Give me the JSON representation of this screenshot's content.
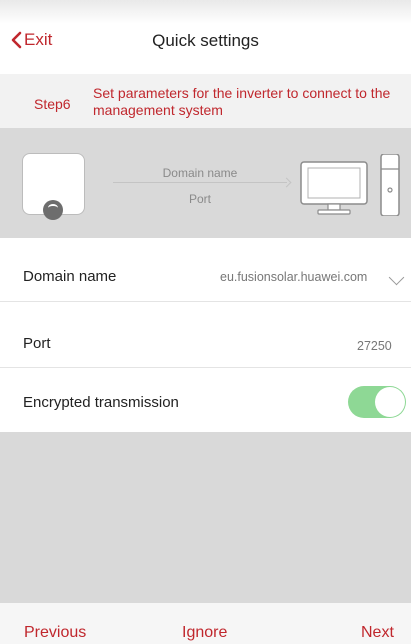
{
  "header": {
    "exit_label": "Exit",
    "title": "Quick settings"
  },
  "step": {
    "label": "Step6",
    "description": "Set parameters for the inverter to connect to the management system"
  },
  "diagram": {
    "line1": "Domain name",
    "line2": "Port",
    "left_device_icon": "inverter-icon",
    "right_device_icon": "computer-icon"
  },
  "settings": {
    "domain": {
      "label": "Domain name",
      "value": "eu.fusionsolar.huawei.com"
    },
    "port": {
      "label": "Port",
      "value": "27250"
    },
    "encrypted": {
      "label": "Encrypted transmission",
      "enabled": true
    }
  },
  "footer": {
    "previous": "Previous",
    "ignore": "Ignore",
    "next": "Next"
  },
  "colors": {
    "accent": "#c0272d",
    "toggle_on": "#8ed895",
    "panel_gray": "#d9d9d9"
  }
}
